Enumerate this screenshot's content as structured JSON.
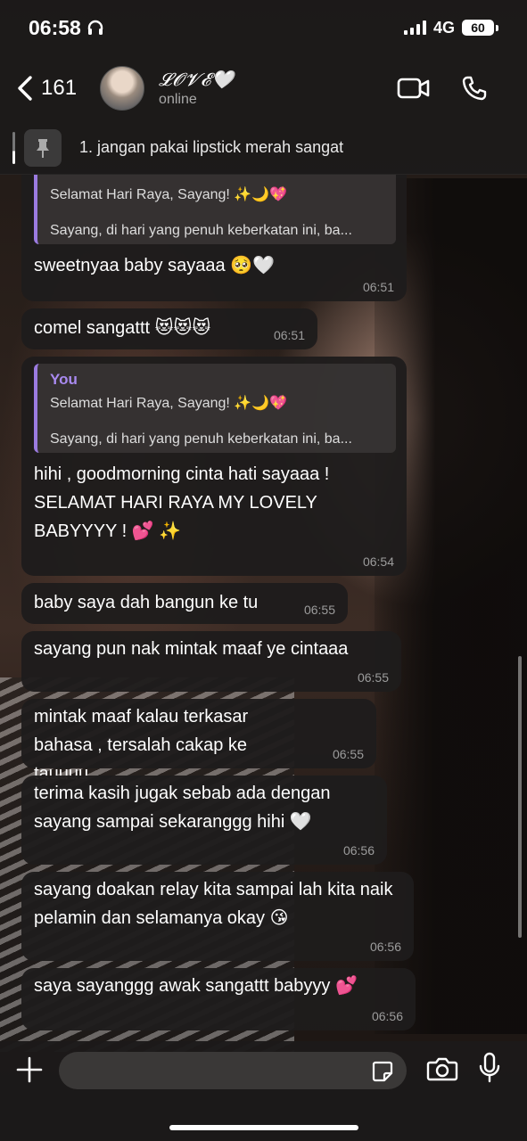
{
  "status_bar": {
    "time": "06:58",
    "network": "4G",
    "battery": "60"
  },
  "header": {
    "back_count": "161",
    "contact_name": "𝓛𝓞𝓥𝓔🤍",
    "contact_status": "online"
  },
  "pinned": {
    "text": "1. jangan pakai lipstick merah sangat"
  },
  "messages": [
    {
      "quote": {
        "author": "",
        "title": "Selamat Hari Raya, Sayang! ✨🌙💖",
        "body": "Sayang, di hari yang penuh keberkatan ini, ba..."
      },
      "text": "sweetnyaa baby sayaaa 🥺🤍",
      "time": "06:51"
    },
    {
      "text": "comel sangattt 😻😻😻",
      "time": "06:51"
    },
    {
      "quote": {
        "author": "You",
        "title": "Selamat Hari Raya, Sayang! ✨🌙💖",
        "body": "Sayang, di hari yang penuh keberkatan ini, ba..."
      },
      "text": "hihi , goodmorning cinta hati sayaaa ! SELAMAT HARI RAYA MY LOVELY BABYYYY ! 💕 ✨",
      "time": "06:54"
    },
    {
      "text": "baby saya dah bangun ke tu",
      "time": "06:55"
    },
    {
      "text": "sayang pun nak mintak maaf ye cintaaa",
      "time": "06:55"
    },
    {
      "text": "mintak maaf kalau terkasar bahasa , tersalah cakap ke tauuuu",
      "time": "06:55"
    },
    {
      "text": "terima kasih jugak sebab ada dengan sayang sampai sekaranggg hihi 🤍",
      "time": "06:56"
    },
    {
      "text": "sayang doakan relay kita sampai lah kita naik pelamin dan selamanya okay 😘",
      "time": "06:56"
    },
    {
      "text": "saya sayanggg awak sangattt babyyy 💕",
      "time": "06:56"
    }
  ],
  "input": {
    "placeholder": ""
  },
  "icons": {
    "back": "chevron-left-icon",
    "video": "video-call-icon",
    "phone": "phone-icon",
    "pin": "pin-icon",
    "plus": "plus-icon",
    "sticker": "sticker-icon",
    "camera": "camera-icon",
    "mic": "microphone-icon"
  },
  "colors": {
    "quote_accent": "#9b7be0",
    "quote_author": "#a98af0"
  }
}
